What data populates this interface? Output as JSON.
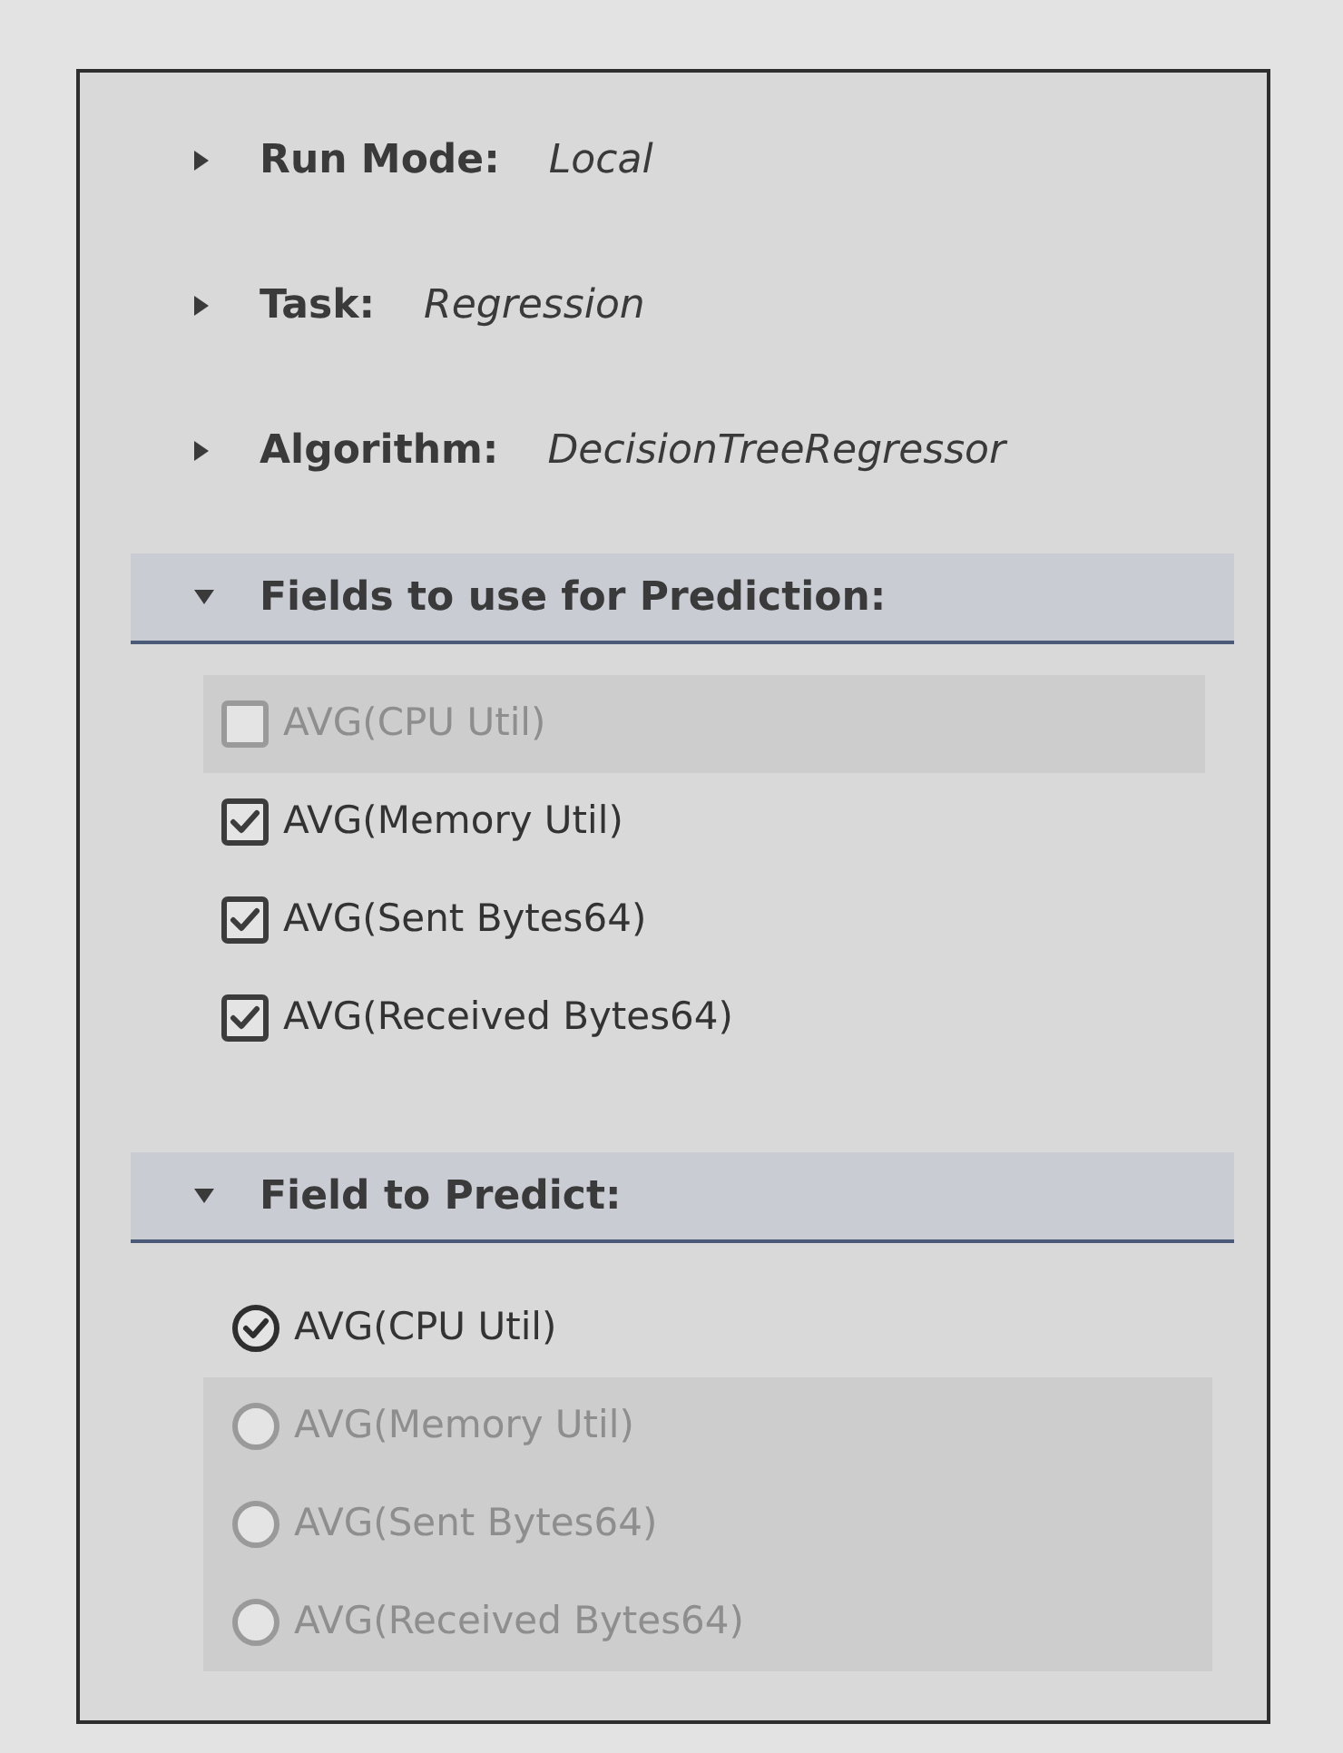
{
  "settings": [
    {
      "label": "Run Mode:",
      "value": "Local",
      "expanded": false
    },
    {
      "label": "Task:",
      "value": "Regression",
      "expanded": false
    },
    {
      "label": "Algorithm:",
      "value": "DecisionTreeRegressor",
      "expanded": false
    }
  ],
  "sections": [
    {
      "title": "Fields to use for Prediction:",
      "expanded": true,
      "kind": "checkbox",
      "options": [
        {
          "label": "AVG(CPU Util)",
          "checked": false,
          "disabled": true
        },
        {
          "label": "AVG(Memory Util)",
          "checked": true,
          "disabled": false
        },
        {
          "label": "AVG(Sent Bytes64)",
          "checked": true,
          "disabled": false
        },
        {
          "label": "AVG(Received Bytes64)",
          "checked": true,
          "disabled": false
        }
      ]
    },
    {
      "title": "Field to Predict:",
      "expanded": true,
      "kind": "radio",
      "options": [
        {
          "label": "AVG(CPU Util)",
          "selected": true,
          "disabled": false
        },
        {
          "label": "AVG(Memory Util)",
          "selected": false,
          "disabled": true
        },
        {
          "label": "AVG(Sent Bytes64)",
          "selected": false,
          "disabled": true
        },
        {
          "label": "AVG(Received Bytes64)",
          "selected": false,
          "disabled": true
        }
      ]
    }
  ]
}
